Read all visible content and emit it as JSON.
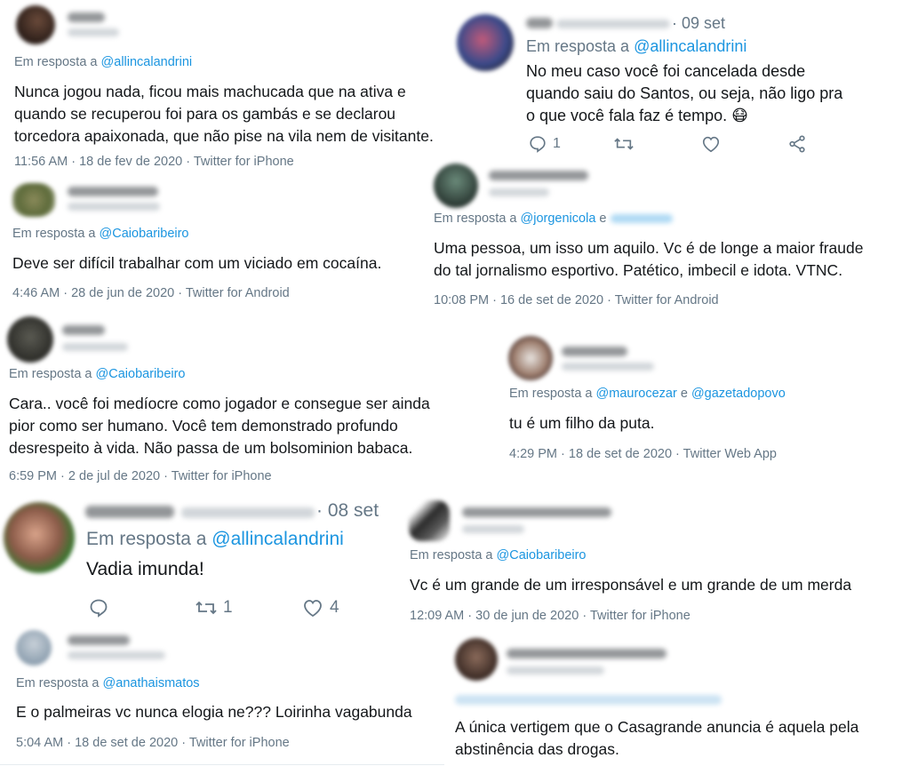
{
  "reply_prefix": "Em resposta a",
  "and_word": "e",
  "dot": "·",
  "tweets": [
    {
      "id": "t1",
      "mentions": [
        "@allincalandrini"
      ],
      "text_lines": [
        "Nunca jogou nada, ficou mais machucada que na ativa e",
        "quando se recuperou foi para os gambás e se declarou",
        "torcedora apaixonada, que não pise na vila nem de visitante."
      ],
      "time": "11:56 AM",
      "date": "18 de fev de 2020",
      "client": "Twitter for iPhone"
    },
    {
      "id": "t2",
      "mentions": [
        "@Caiobaribeiro"
      ],
      "text_lines": [
        "Deve ser difícil trabalhar com um viciado em cocaína."
      ],
      "time": "4:46 AM",
      "date": "28 de jun de 2020",
      "client": "Twitter for Android"
    },
    {
      "id": "t3",
      "mentions": [
        "@Caiobaribeiro"
      ],
      "text_lines": [
        "Cara.. você foi medíocre como jogador e consegue ser ainda",
        "pior como ser humano. Você tem demonstrado profundo",
        "desrespeito à vida. Não passa de um bolsominion babaca."
      ],
      "time": "6:59 PM",
      "date": "2 de jul de 2020",
      "client": "Twitter for iPhone"
    },
    {
      "id": "t4",
      "mentions": [
        "@allincalandrini"
      ],
      "text_lines": [
        "Vadia imunda!"
      ],
      "date_short": "08 set",
      "retweets": "1",
      "likes": "4"
    },
    {
      "id": "t5",
      "mentions": [
        "@anathaismatos"
      ],
      "text_lines": [
        "E o palmeiras vc nunca elogia ne??? Loirinha vagabunda"
      ],
      "time": "5:04 AM",
      "date": "18 de set de 2020",
      "client": "Twitter for iPhone"
    },
    {
      "id": "t6",
      "mentions": [
        "@allincalandrini"
      ],
      "text_lines": [
        "No meu caso você foi cancelada desde",
        "quando saiu do Santos, ou seja,  não ligo  pra",
        "o que você fala faz é tempo. 😷"
      ],
      "date_short": "09 set",
      "replies": "1"
    },
    {
      "id": "t7",
      "mentions": [
        "@jorgenicola"
      ],
      "text_lines": [
        "Uma pessoa, um isso um aquilo. Vc é de longe a maior fraude",
        "do tal jornalismo esportivo. Patético, imbecil e idota. VTNC."
      ],
      "time": "10:08 PM",
      "date": "16 de set de 2020",
      "client": "Twitter for Android"
    },
    {
      "id": "t8",
      "mentions": [
        "@maurocezar",
        "@gazetadopovo"
      ],
      "text_lines": [
        "tu é um filho da puta."
      ],
      "time": "4:29 PM",
      "date": "18 de set de 2020",
      "client": "Twitter Web App"
    },
    {
      "id": "t9",
      "mentions": [
        "@Caiobaribeiro"
      ],
      "text_lines": [
        "Vc é um grande de um irresponsável e um grande de um merda"
      ],
      "time": "12:09 AM",
      "date": "30 de jun de 2020",
      "client": "Twitter for iPhone"
    },
    {
      "id": "t10",
      "text_lines": [
        "A única vertigem que o Casagrande anuncia é aquela pela",
        "abstinência das drogas."
      ]
    }
  ],
  "colors": {
    "link": "#1b95e0",
    "meta": "#657786",
    "text": "#14171a",
    "divider": "#e6ecf0"
  },
  "icons": [
    "reply-icon",
    "retweet-icon",
    "like-icon",
    "share-icon",
    "mask-emoji"
  ]
}
